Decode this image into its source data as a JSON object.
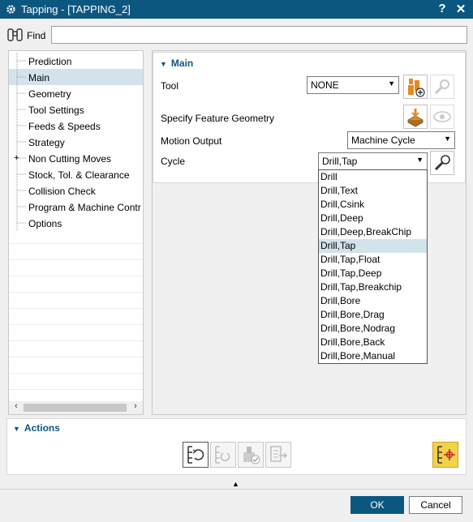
{
  "window": {
    "title": "Tapping - [TAPPING_2]",
    "help": "?",
    "close": "✕"
  },
  "find": {
    "label": "Find",
    "value": ""
  },
  "tree": [
    {
      "label": "Prediction"
    },
    {
      "label": "Main"
    },
    {
      "label": "Geometry"
    },
    {
      "label": "Tool Settings"
    },
    {
      "label": "Feeds & Speeds"
    },
    {
      "label": "Strategy"
    },
    {
      "label": "Non Cutting Moves"
    },
    {
      "label": "Stock, Tol. & Clearance"
    },
    {
      "label": "Collision Check"
    },
    {
      "label": "Program & Machine Contr"
    },
    {
      "label": "Options"
    }
  ],
  "main": {
    "header": "Main",
    "tool_label": "Tool",
    "tool_value": "NONE",
    "feature_label": "Specify Feature Geometry",
    "motion_label": "Motion Output",
    "motion_value": "Machine Cycle",
    "cycle_label": "Cycle",
    "cycle_value": "Drill,Tap"
  },
  "cycle_options": [
    "Drill",
    "Drill,Text",
    "Drill,Csink",
    "Drill,Deep",
    "Drill,Deep,BreakChip",
    "Drill,Tap",
    "Drill,Tap,Float",
    "Drill,Tap,Deep",
    "Drill,Tap,Breakchip",
    "Drill,Bore",
    "Drill,Bore,Drag",
    "Drill,Bore,Nodrag",
    "Drill,Bore,Back",
    "Drill,Bore,Manual"
  ],
  "actions": {
    "header": "Actions"
  },
  "buttons": {
    "ok": "OK",
    "cancel": "Cancel"
  },
  "colors": {
    "titlebar": "#0c5780",
    "selection": "#d3e3ec",
    "accent_orange": "#e38a1e",
    "highlight_yellow": "#f2d14b"
  }
}
